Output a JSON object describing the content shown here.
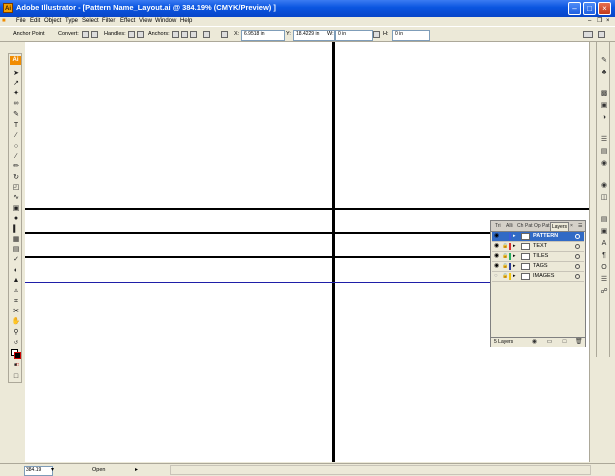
{
  "window": {
    "title": "Adobe Illustrator - [Pattern Name_Layout.ai @ 384.19% (CMYK/Preview) ]",
    "app_icon_text": "Ai"
  },
  "menu": [
    "File",
    "Edit",
    "Object",
    "Type",
    "Select",
    "Filter",
    "Effect",
    "View",
    "Window",
    "Help"
  ],
  "control_bar": {
    "mode_label": "Anchor Point",
    "convert_label": "Convert:",
    "handles_label": "Handles:",
    "anchors_label": "Anchors:",
    "x_label": "X:",
    "x_value": "6.9518 in",
    "y_label": "Y:",
    "y_value": "18.4229 in",
    "w_label": "W:",
    "w_value": "0 in",
    "h_label": "H:",
    "h_value": "0 in"
  },
  "toolbox": {
    "logo": "Ai",
    "tools": [
      "selection-tool",
      "direct-selection-tool",
      "magic-wand-tool",
      "lasso-tool",
      "pen-tool",
      "type-tool",
      "line-tool",
      "rectangle-tool",
      "paintbrush-tool",
      "pencil-tool",
      "blob-tool",
      "rotate-tool",
      "scale-tool",
      "warp-tool",
      "free-transform-tool",
      "symbol-sprayer-tool",
      "column-graph-tool",
      "mesh-tool",
      "gradient-tool",
      "eyedropper-tool",
      "blend-tool",
      "live-paint-tool",
      "live-paint-selection-tool",
      "crop-tool",
      "slice-tool",
      "scissors-tool",
      "hand-tool",
      "zoom-tool",
      "fill-stroke-swatch",
      "swap-icon",
      "color-mode-icons",
      "screen-mode-icon"
    ]
  },
  "layers_panel": {
    "tabs": [
      "Tri",
      "Alli",
      "Ch",
      "Pat",
      "Op",
      "Pat",
      "Layers"
    ],
    "active_tab": "Layers",
    "layers": [
      {
        "name": "PATTERN",
        "color": "#3b5bdb",
        "selected": true,
        "locked": false
      },
      {
        "name": "TEXT",
        "color": "#d63031",
        "selected": false,
        "locked": true
      },
      {
        "name": "TILES",
        "color": "#27ae60",
        "selected": false,
        "locked": true
      },
      {
        "name": "TAGS",
        "color": "#2c3e99",
        "selected": false,
        "locked": true
      },
      {
        "name": "IMAGES",
        "color": "#f1c40f",
        "selected": false,
        "locked": true
      }
    ],
    "footer_count": "5 Layers"
  },
  "status_bar": {
    "zoom": "384.19",
    "status": "Open"
  },
  "colors": {
    "titlebar": "#0a55e0",
    "chrome": "#ece9d8",
    "canvas": "#ffffff",
    "selection": "#316ac5",
    "guide_blue": "#1f1fa8"
  }
}
